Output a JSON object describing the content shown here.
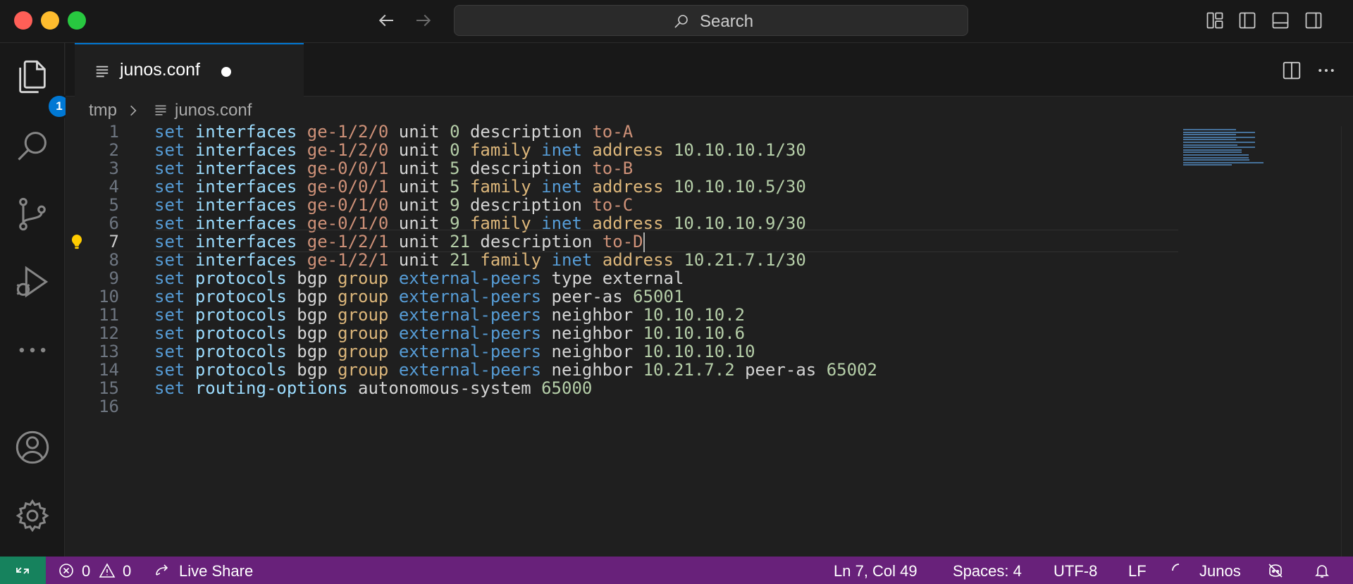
{
  "titlebar": {
    "search_label": "Search"
  },
  "activity": {
    "explorer_badge": "1"
  },
  "tab": {
    "label": "junos.conf"
  },
  "breadcrumb": {
    "folder": "tmp",
    "file": "junos.conf"
  },
  "editor": {
    "current_line": 7,
    "lines": [
      {
        "n": "1",
        "tokens": [
          [
            "set",
            "k-set"
          ],
          [
            " "
          ],
          [
            "interfaces",
            "k-kw"
          ],
          [
            " "
          ],
          [
            "ge-1/2/0",
            "k-val"
          ],
          [
            " unit ",
            "k-plain"
          ],
          [
            "0",
            "k-num"
          ],
          [
            " description ",
            "k-plain"
          ],
          [
            "to-A",
            "k-val"
          ]
        ]
      },
      {
        "n": "2",
        "tokens": [
          [
            "set",
            "k-set"
          ],
          [
            " "
          ],
          [
            "interfaces",
            "k-kw"
          ],
          [
            " "
          ],
          [
            "ge-1/2/0",
            "k-val"
          ],
          [
            " unit ",
            "k-plain"
          ],
          [
            "0",
            "k-num"
          ],
          [
            " "
          ],
          [
            "family",
            "k-gold"
          ],
          [
            " "
          ],
          [
            "inet",
            "k-type"
          ],
          [
            " "
          ],
          [
            "address",
            "k-gold"
          ],
          [
            " "
          ],
          [
            "10.10.10.1/30",
            "k-num"
          ]
        ]
      },
      {
        "n": "3",
        "tokens": [
          [
            "set",
            "k-set"
          ],
          [
            " "
          ],
          [
            "interfaces",
            "k-kw"
          ],
          [
            " "
          ],
          [
            "ge-0/0/1",
            "k-val"
          ],
          [
            " unit ",
            "k-plain"
          ],
          [
            "5",
            "k-num"
          ],
          [
            " description ",
            "k-plain"
          ],
          [
            "to-B",
            "k-val"
          ]
        ]
      },
      {
        "n": "4",
        "tokens": [
          [
            "set",
            "k-set"
          ],
          [
            " "
          ],
          [
            "interfaces",
            "k-kw"
          ],
          [
            " "
          ],
          [
            "ge-0/0/1",
            "k-val"
          ],
          [
            " unit ",
            "k-plain"
          ],
          [
            "5",
            "k-num"
          ],
          [
            " "
          ],
          [
            "family",
            "k-gold"
          ],
          [
            " "
          ],
          [
            "inet",
            "k-type"
          ],
          [
            " "
          ],
          [
            "address",
            "k-gold"
          ],
          [
            " "
          ],
          [
            "10.10.10.5/30",
            "k-num"
          ]
        ]
      },
      {
        "n": "5",
        "tokens": [
          [
            "set",
            "k-set"
          ],
          [
            " "
          ],
          [
            "interfaces",
            "k-kw"
          ],
          [
            " "
          ],
          [
            "ge-0/1/0",
            "k-val"
          ],
          [
            " unit ",
            "k-plain"
          ],
          [
            "9",
            "k-num"
          ],
          [
            " description ",
            "k-plain"
          ],
          [
            "to-C",
            "k-val"
          ]
        ]
      },
      {
        "n": "6",
        "tokens": [
          [
            "set",
            "k-set"
          ],
          [
            " "
          ],
          [
            "interfaces",
            "k-kw"
          ],
          [
            " "
          ],
          [
            "ge-0/1/0",
            "k-val"
          ],
          [
            " unit ",
            "k-plain"
          ],
          [
            "9",
            "k-num"
          ],
          [
            " "
          ],
          [
            "family",
            "k-gold"
          ],
          [
            " "
          ],
          [
            "inet",
            "k-type"
          ],
          [
            " "
          ],
          [
            "address",
            "k-gold"
          ],
          [
            " "
          ],
          [
            "10.10.10.9/30",
            "k-num"
          ]
        ]
      },
      {
        "n": "7",
        "tokens": [
          [
            "set",
            "k-set"
          ],
          [
            " "
          ],
          [
            "interfaces",
            "k-kw"
          ],
          [
            " "
          ],
          [
            "ge-1/2/1",
            "k-val"
          ],
          [
            " unit ",
            "k-plain"
          ],
          [
            "21",
            "k-num"
          ],
          [
            " description ",
            "k-plain"
          ],
          [
            "to-D",
            "k-val"
          ]
        ]
      },
      {
        "n": "8",
        "tokens": [
          [
            "set",
            "k-set"
          ],
          [
            " "
          ],
          [
            "interfaces",
            "k-kw"
          ],
          [
            " "
          ],
          [
            "ge-1/2/1",
            "k-val"
          ],
          [
            " unit ",
            "k-plain"
          ],
          [
            "21",
            "k-num"
          ],
          [
            " "
          ],
          [
            "family",
            "k-gold"
          ],
          [
            " "
          ],
          [
            "inet",
            "k-type"
          ],
          [
            " "
          ],
          [
            "address",
            "k-gold"
          ],
          [
            " "
          ],
          [
            "10.21.7.1/30",
            "k-num"
          ]
        ]
      },
      {
        "n": "9",
        "tokens": [
          [
            "set",
            "k-set"
          ],
          [
            " "
          ],
          [
            "protocols",
            "k-kw"
          ],
          [
            " bgp ",
            "k-plain"
          ],
          [
            "group",
            "k-gold"
          ],
          [
            " "
          ],
          [
            "external-peers",
            "k-type"
          ],
          [
            " type external",
            "k-plain"
          ]
        ]
      },
      {
        "n": "10",
        "tokens": [
          [
            "set",
            "k-set"
          ],
          [
            " "
          ],
          [
            "protocols",
            "k-kw"
          ],
          [
            " bgp ",
            "k-plain"
          ],
          [
            "group",
            "k-gold"
          ],
          [
            " "
          ],
          [
            "external-peers",
            "k-type"
          ],
          [
            " peer-as ",
            "k-plain"
          ],
          [
            "65001",
            "k-num"
          ]
        ]
      },
      {
        "n": "11",
        "tokens": [
          [
            "set",
            "k-set"
          ],
          [
            " "
          ],
          [
            "protocols",
            "k-kw"
          ],
          [
            " bgp ",
            "k-plain"
          ],
          [
            "group",
            "k-gold"
          ],
          [
            " "
          ],
          [
            "external-peers",
            "k-type"
          ],
          [
            " neighbor ",
            "k-plain"
          ],
          [
            "10.10.10.2",
            "k-num"
          ]
        ]
      },
      {
        "n": "12",
        "tokens": [
          [
            "set",
            "k-set"
          ],
          [
            " "
          ],
          [
            "protocols",
            "k-kw"
          ],
          [
            " bgp ",
            "k-plain"
          ],
          [
            "group",
            "k-gold"
          ],
          [
            " "
          ],
          [
            "external-peers",
            "k-type"
          ],
          [
            " neighbor ",
            "k-plain"
          ],
          [
            "10.10.10.6",
            "k-num"
          ]
        ]
      },
      {
        "n": "13",
        "tokens": [
          [
            "set",
            "k-set"
          ],
          [
            " "
          ],
          [
            "protocols",
            "k-kw"
          ],
          [
            " bgp ",
            "k-plain"
          ],
          [
            "group",
            "k-gold"
          ],
          [
            " "
          ],
          [
            "external-peers",
            "k-type"
          ],
          [
            " neighbor ",
            "k-plain"
          ],
          [
            "10.10.10.10",
            "k-num"
          ]
        ]
      },
      {
        "n": "14",
        "tokens": [
          [
            "set",
            "k-set"
          ],
          [
            " "
          ],
          [
            "protocols",
            "k-kw"
          ],
          [
            " bgp ",
            "k-plain"
          ],
          [
            "group",
            "k-gold"
          ],
          [
            " "
          ],
          [
            "external-peers",
            "k-type"
          ],
          [
            " neighbor ",
            "k-plain"
          ],
          [
            "10.21.7.2",
            "k-num"
          ],
          [
            " peer-as ",
            "k-plain"
          ],
          [
            "65002",
            "k-num"
          ]
        ]
      },
      {
        "n": "15",
        "tokens": [
          [
            "set",
            "k-set"
          ],
          [
            " "
          ],
          [
            "routing-options",
            "k-kw"
          ],
          [
            " autonomous-system ",
            "k-plain"
          ],
          [
            "65000",
            "k-num"
          ]
        ]
      },
      {
        "n": "16",
        "tokens": []
      }
    ]
  },
  "status": {
    "errors": "0",
    "warnings": "0",
    "live_share": "Live Share",
    "position": "Ln 7, Col 49",
    "spaces": "Spaces: 4",
    "encoding": "UTF-8",
    "eol": "LF",
    "language": "Junos"
  },
  "colors": {
    "status_bg": "#68217a",
    "remote_bg": "#16825d",
    "accent": "#0078d4"
  }
}
